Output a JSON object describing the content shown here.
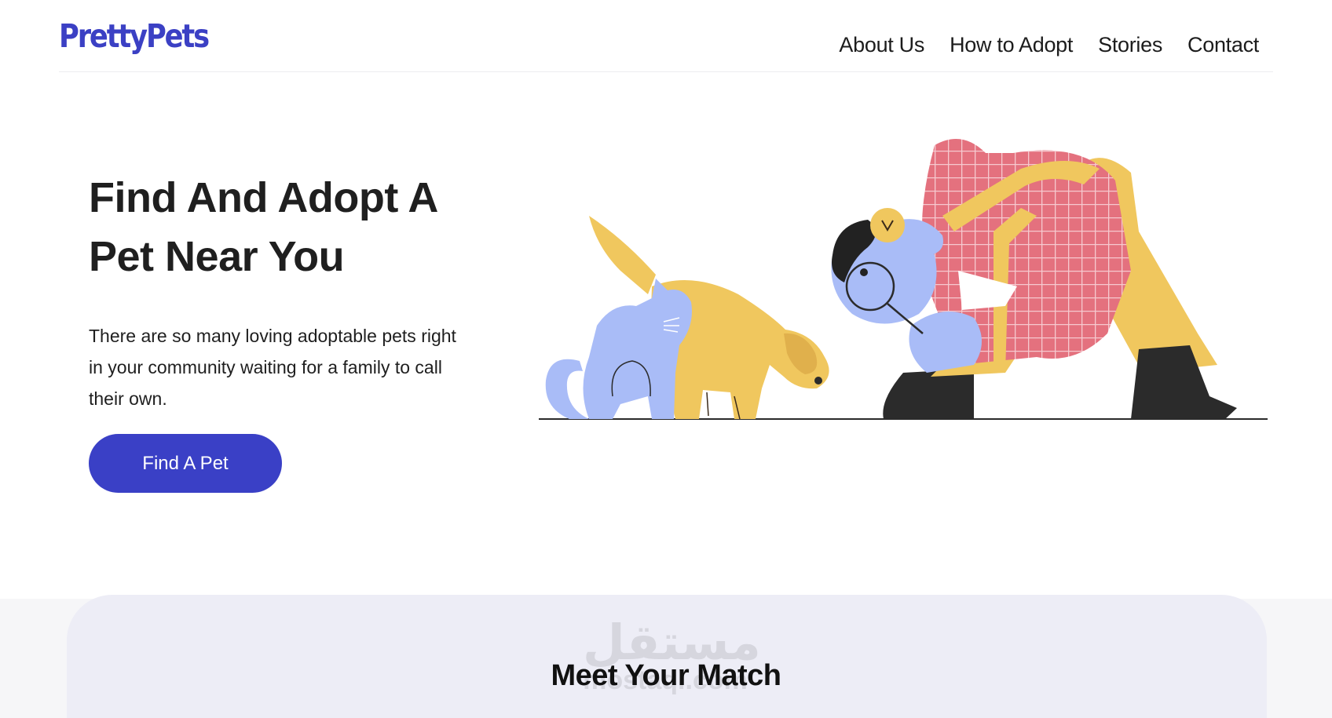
{
  "brand": {
    "logo_text": "PrettyPets",
    "color": "#3b40c4"
  },
  "nav": {
    "items": [
      {
        "label": "About Us"
      },
      {
        "label": "How to Adopt"
      },
      {
        "label": "Stories"
      },
      {
        "label": "Contact"
      }
    ]
  },
  "hero": {
    "title": "Find And Adopt A Pet Near You",
    "description": "There are so many loving adoptable pets right in your community waiting for a family to call their own.",
    "cta_label": "Find A Pet",
    "illustration": "person-with-magnifying-glass-looking-at-cat-and-dog",
    "accent_color": "#3a40c6"
  },
  "match": {
    "title": "Meet Your Match",
    "watermark_arabic": "مستقل",
    "watermark_latin": "mostaql.com"
  }
}
